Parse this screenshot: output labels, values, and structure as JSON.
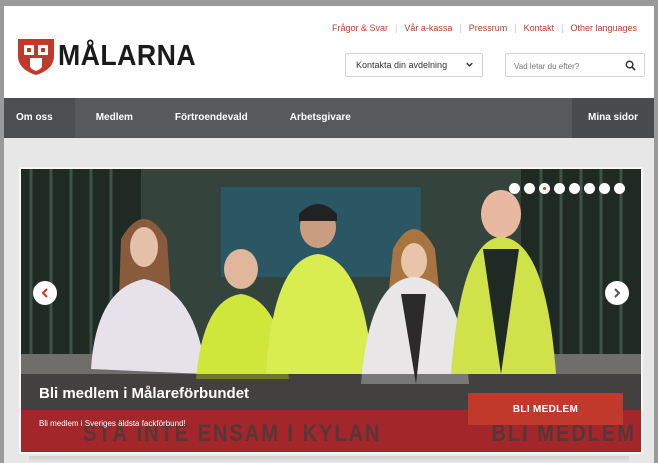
{
  "brand": {
    "name": "MÅLARNA",
    "accent": "#c0392b"
  },
  "toplinks": [
    "Frågor & Svar",
    "Vår a-kassa",
    "Pressrum",
    "Kontakt",
    "Other languages"
  ],
  "department_select": {
    "value": "Kontakta din avdelning"
  },
  "search": {
    "placeholder": "Vad letar du efter?",
    "icon": "search-icon"
  },
  "nav": {
    "items": [
      "Om oss",
      "Medlem",
      "Förtroendevald",
      "Arbetsgivare"
    ],
    "right_item": "Mina sidor"
  },
  "slider": {
    "title": "Bli medlem i Målareförbundet",
    "subtitle": "Bli medlem i Sveriges äldsta fackförbund!",
    "cta": "BLI MEDLEM",
    "background_text_left": "STÅ INTE ENSAM I KYLAN",
    "background_text_right": "BLI MEDLEM NU",
    "slide_count": 8,
    "active_slide": 3
  }
}
